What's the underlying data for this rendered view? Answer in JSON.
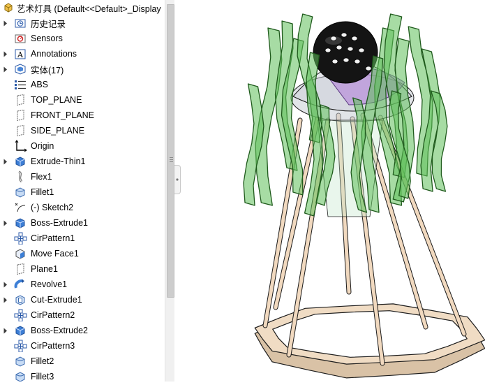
{
  "tree": {
    "header_label": "艺术灯具  (Default<<Default>_Display",
    "items": [
      {
        "label": "历史记录",
        "icon": "history-folder-icon",
        "expandable": true
      },
      {
        "label": "Sensors",
        "icon": "sensors-icon",
        "expandable": false
      },
      {
        "label": "Annotations",
        "icon": "annotations-icon",
        "expandable": true
      },
      {
        "label": "实体(17)",
        "icon": "solid-bodies-folder-icon",
        "expandable": true
      },
      {
        "label": "ABS",
        "icon": "material-icon",
        "expandable": false
      },
      {
        "label": "TOP_PLANE",
        "icon": "plane-icon",
        "expandable": false
      },
      {
        "label": "FRONT_PLANE",
        "icon": "plane-icon",
        "expandable": false
      },
      {
        "label": "SIDE_PLANE",
        "icon": "plane-icon",
        "expandable": false
      },
      {
        "label": "Origin",
        "icon": "origin-icon",
        "expandable": false
      },
      {
        "label": "Extrude-Thin1",
        "icon": "extrude-icon",
        "expandable": true
      },
      {
        "label": "Flex1",
        "icon": "flex-icon",
        "expandable": false
      },
      {
        "label": "Fillet1",
        "icon": "fillet-icon",
        "expandable": false
      },
      {
        "label": "(-) Sketch2",
        "icon": "sketch-icon",
        "expandable": false
      },
      {
        "label": "Boss-Extrude1",
        "icon": "extrude-icon",
        "expandable": true
      },
      {
        "label": "CirPattern1",
        "icon": "circular-pattern-icon",
        "expandable": false
      },
      {
        "label": "Move Face1",
        "icon": "move-face-icon",
        "expandable": false
      },
      {
        "label": "Plane1",
        "icon": "plane-icon",
        "expandable": false
      },
      {
        "label": "Revolve1",
        "icon": "revolve-icon",
        "expandable": true
      },
      {
        "label": "Cut-Extrude1",
        "icon": "cut-extrude-icon",
        "expandable": true
      },
      {
        "label": "CirPattern2",
        "icon": "circular-pattern-icon",
        "expandable": false
      },
      {
        "label": "Boss-Extrude2",
        "icon": "extrude-icon",
        "expandable": true
      },
      {
        "label": "CirPattern3",
        "icon": "circular-pattern-icon",
        "expandable": false
      },
      {
        "label": "Fillet2",
        "icon": "fillet-icon",
        "expandable": false
      },
      {
        "label": "Fillet3",
        "icon": "fillet-icon",
        "expandable": false
      }
    ]
  },
  "colors": {
    "ribbon_green": "#5fbf5a",
    "ribbon_dark": "#1f5a1c",
    "dome_purple": "#b07ad8",
    "shade_grey": "#c9cdd6",
    "ball_black": "#141414",
    "rod_wood": "#f1d9bf",
    "base_wood": "#f0dcc4",
    "outline": "#1c1c1c"
  }
}
